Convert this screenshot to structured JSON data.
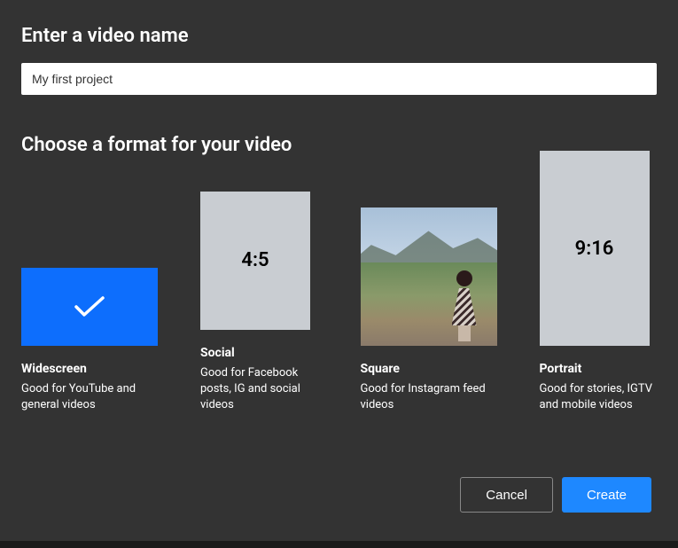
{
  "header": {
    "title": "Enter a video name"
  },
  "nameInput": {
    "value": "My first project"
  },
  "formatSection": {
    "title": "Choose a format for your video"
  },
  "formats": {
    "widescreen": {
      "ratio": "",
      "label": "Widescreen",
      "desc": "Good for YouTube and general videos"
    },
    "social": {
      "ratio": "4:5",
      "label": "Social",
      "desc": "Good for Facebook posts, IG and social videos"
    },
    "square": {
      "ratio": "",
      "label": "Square",
      "desc": "Good for Instagram feed videos"
    },
    "portrait": {
      "ratio": "9:16",
      "label": "Portrait",
      "desc": "Good for stories, IGTV and mobile videos"
    }
  },
  "buttons": {
    "cancel": "Cancel",
    "create": "Create"
  }
}
